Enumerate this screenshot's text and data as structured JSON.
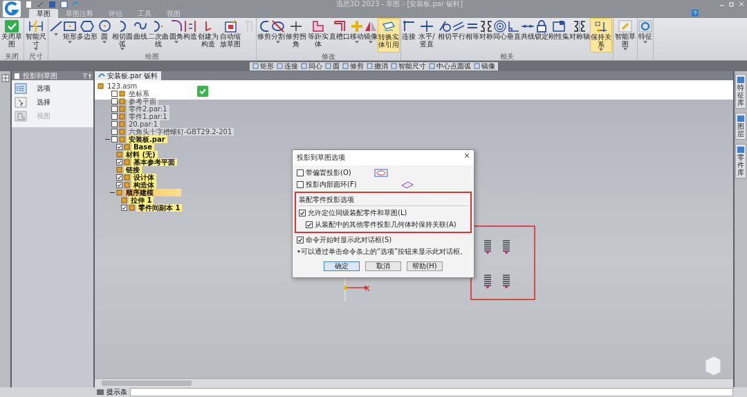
{
  "window": {
    "title": "迅思3D 2023 - 草图 - [安装板.par 钣料]"
  },
  "ribbon_tabs": [
    {
      "label": "草图",
      "selected": true
    },
    {
      "label": "草图注释",
      "selected": false
    },
    {
      "label": "评估",
      "selected": false
    },
    {
      "label": "工具",
      "selected": false
    },
    {
      "label": "视图",
      "selected": false
    }
  ],
  "ribbon_groups": [
    {
      "label": "关闭",
      "buttons": [
        {
          "label": "关闭草图",
          "highlighted": false,
          "disabled": false,
          "dropdown": false
        }
      ]
    },
    {
      "label": "尺寸",
      "buttons": [
        {
          "label": "智能尺寸",
          "highlighted": false,
          "disabled": false,
          "dropdown": true
        }
      ]
    },
    {
      "label": "绘图",
      "buttons": [
        {
          "highlighted": false,
          "disabled": false,
          "dropdown": true
        },
        {
          "label": "矩形",
          "highlighted": false,
          "disabled": false,
          "dropdown": true
        },
        {
          "label": "多边形",
          "highlighted": false,
          "disabled": false,
          "dropdown": false
        },
        {
          "label": "圆",
          "highlighted": false,
          "disabled": false,
          "dropdown": true
        },
        {
          "label": "相切圆弧",
          "highlighted": false,
          "disabled": false,
          "dropdown": true
        },
        {
          "label": "曲线",
          "highlighted": false,
          "disabled": false,
          "dropdown": false
        },
        {
          "label": "二次曲线",
          "highlighted": false,
          "disabled": false,
          "dropdown": false
        },
        {
          "label": "圆角",
          "highlighted": false,
          "disabled": false,
          "dropdown": true
        },
        {
          "label": "构造",
          "highlighted": false,
          "disabled": false,
          "dropdown": false
        },
        {
          "label": "创建为构造",
          "highlighted": false,
          "disabled": false,
          "dropdown": false
        },
        {
          "label": "自动缩放草图",
          "highlighted": false,
          "disabled": false,
          "dropdown": false
        },
        {
          "highlighted": false,
          "disabled": true,
          "dropdown": false
        }
      ]
    },
    {
      "label": "修改",
      "buttons": [
        {
          "label": "修剪",
          "highlighted": false,
          "disabled": false,
          "dropdown": false
        },
        {
          "label": "分割",
          "highlighted": false,
          "disabled": false,
          "dropdown": true
        },
        {
          "label": "修剪拐角",
          "highlighted": false,
          "disabled": false,
          "dropdown": false
        },
        {
          "label": "等距实体",
          "highlighted": false,
          "disabled": false,
          "dropdown": false
        },
        {
          "label": "直槽口",
          "highlighted": false,
          "disabled": false,
          "dropdown": false
        },
        {
          "label": "移动",
          "highlighted": false,
          "disabled": false,
          "dropdown": true
        },
        {
          "label": "镜像",
          "highlighted": false,
          "disabled": false,
          "dropdown": true
        },
        {
          "label": "转换实体引用",
          "highlighted": true,
          "disabled": false,
          "dropdown": false
        }
      ]
    },
    {
      "label": "相关",
      "buttons": [
        {
          "label": "连接",
          "highlighted": false,
          "disabled": false,
          "dropdown": false
        },
        {
          "label": "水平/竖直",
          "highlighted": false,
          "disabled": false,
          "dropdown": false
        },
        {
          "label": "相切",
          "highlighted": false,
          "disabled": false,
          "dropdown": false
        },
        {
          "label": "平行",
          "highlighted": false,
          "disabled": false,
          "dropdown": false
        },
        {
          "label": "相等",
          "highlighted": false,
          "disabled": false,
          "dropdown": false
        },
        {
          "label": "对称",
          "highlighted": false,
          "disabled": false,
          "dropdown": false
        },
        {
          "label": "同心",
          "highlighted": false,
          "disabled": false,
          "dropdown": false
        },
        {
          "label": "垂直",
          "highlighted": false,
          "disabled": false,
          "dropdown": false
        },
        {
          "label": "共线",
          "highlighted": false,
          "disabled": false,
          "dropdown": false
        },
        {
          "label": "锁定",
          "highlighted": false,
          "disabled": false,
          "dropdown": false
        },
        {
          "label": "刚性集",
          "highlighted": false,
          "disabled": false,
          "dropdown": false
        },
        {
          "label": "对称轴",
          "highlighted": false,
          "disabled": false,
          "dropdown": false
        },
        {
          "label": "保持关系",
          "highlighted": true,
          "disabled": false,
          "dropdown": true
        }
      ]
    },
    {
      "buttons": [
        {
          "label": "智能草图",
          "highlighted": false,
          "disabled": false,
          "dropdown": true
        }
      ]
    },
    {
      "buttons": [
        {
          "label": "特征",
          "highlighted": false,
          "disabled": false,
          "dropdown": true
        }
      ]
    }
  ],
  "command_bar": [
    "矩形",
    "连接",
    "同心",
    "圆",
    "修剪",
    "撤消",
    "智能尺寸",
    "中心点圆弧",
    "镜像"
  ],
  "side_panel": {
    "title": "投影到草图",
    "items": [
      {
        "label": "选项",
        "disabled": false
      },
      {
        "label": "选择",
        "disabled": false
      },
      {
        "label": "视图",
        "disabled": true
      }
    ]
  },
  "document_tab": {
    "label": "安装板.par 钣料"
  },
  "tree": [
    {
      "label": "123.asm",
      "highlighted": false,
      "selected": false,
      "children": [
        {
          "label": "坐标系",
          "checked": false,
          "highlighted": false,
          "selected": false
        },
        {
          "label": "参考平面",
          "checked": false,
          "highlighted": false,
          "selected": false
        },
        {
          "label": "零件2.par:1",
          "checked": false,
          "highlighted": false,
          "selected": false
        },
        {
          "label": "零件1.par:1",
          "checked": false,
          "highlighted": false,
          "selected": false
        },
        {
          "label": "20.par:1",
          "checked": false,
          "highlighted": false,
          "selected": false
        },
        {
          "label": "六角头十字槽螺钉-GBT29.2-201",
          "checked": false,
          "highlighted": false,
          "selected": false
        },
        {
          "label": "安装板.par",
          "checked": false,
          "highlighted": true,
          "selected": false,
          "children": [
            {
              "label": "Base",
              "checked": true,
              "highlighted": true,
              "selected": false
            },
            {
              "label": "材料 (无)",
              "highlighted": true,
              "selected": false
            },
            {
              "label": "基本参考平面",
              "checked": true,
              "highlighted": true,
              "selected": false
            },
            {
              "label": "链接",
              "highlighted": true,
              "selected": false
            },
            {
              "label": "设计体",
              "checked": true,
              "highlighted": true,
              "selected": false
            },
            {
              "label": "构造体",
              "checked": true,
              "highlighted": true,
              "selected": false
            },
            {
              "label": "顺序建模",
              "highlighted": true,
              "selected": true,
              "children": [
                {
                  "label": "拉伸 1",
                  "highlighted": true,
                  "selected": false
                },
                {
                  "label": "零件间副本 1",
                  "checked": true,
                  "highlighted": true,
                  "selected": false
                }
              ]
            }
          ]
        }
      ]
    }
  ],
  "dialog": {
    "title": "投影到草图选项",
    "options": [
      {
        "label": "带偏置投影(O)",
        "checked": false
      },
      {
        "label": "投影内部面环(F)",
        "checked": false
      }
    ],
    "group": {
      "title": "装配零件投影选项",
      "options": [
        {
          "label": "允许定位同级装配零件和草图(L)",
          "checked": true
        },
        {
          "label": "从装配中的其他零件投影几何体时保持关联(A)",
          "checked": true
        }
      ]
    },
    "show_option": {
      "label": "命令开始时显示此对话框(S)",
      "checked": true
    },
    "note": "•可以通过单击命令条上的“选项”按钮来显示此对话框。",
    "buttons": [
      "确定",
      "取消",
      "帮助(H)"
    ]
  },
  "axis_label": "X",
  "right_tabs": [
    "特征库",
    "图层",
    "零件库"
  ],
  "status_bar": "提示条"
}
